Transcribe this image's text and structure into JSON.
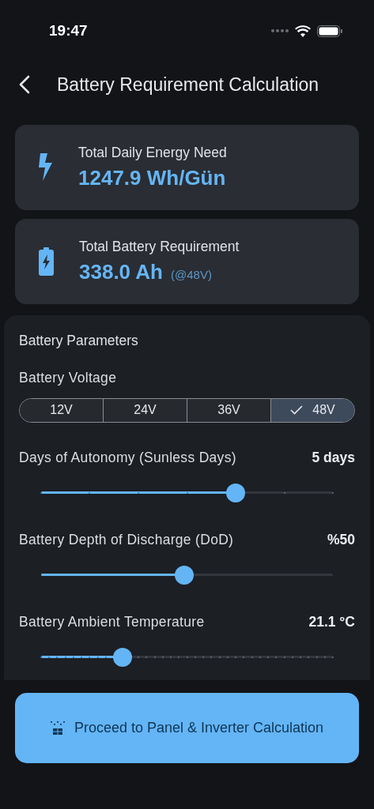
{
  "status_bar": {
    "time": "19:47"
  },
  "header": {
    "title": "Battery Requirement Calculation"
  },
  "summary_cards": [
    {
      "kind": "energy",
      "label": "Total Daily Energy Need",
      "value": "1247.9 Wh/Gün"
    },
    {
      "kind": "battery",
      "label": "Total Battery Requirement",
      "value": "338.0 Ah",
      "note": "(@48V)"
    }
  ],
  "parameters": {
    "title": "Battery Parameters",
    "voltage": {
      "label": "Battery Voltage",
      "options": [
        {
          "label": "12V",
          "selected": false
        },
        {
          "label": "24V",
          "selected": false
        },
        {
          "label": "36V",
          "selected": false
        },
        {
          "label": "48V",
          "selected": true
        }
      ]
    },
    "sliders": [
      {
        "kind": "stepped",
        "label": "Days of Autonomy (Sunless Days)",
        "reading": "5 days",
        "level": 0.667
      },
      {
        "kind": "continuous",
        "label": "Battery Depth of Discharge (DoD)",
        "reading": "%50",
        "level": 0.49
      },
      {
        "kind": "fine",
        "label": "Battery Ambient Temperature",
        "reading": "21.1 °C",
        "level": 0.28
      }
    ]
  },
  "action_button": {
    "label": "Proceed to Panel & Inverter Calculation"
  }
}
